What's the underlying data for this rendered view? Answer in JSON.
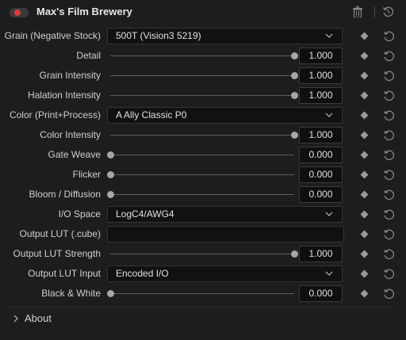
{
  "header": {
    "title": "Max's Film Brewery",
    "enabled": true,
    "toggle_color": "#e03b3b"
  },
  "rows": [
    {
      "label": "Grain (Negative Stock)",
      "type": "select",
      "value": "500T (Vision3 5219)"
    },
    {
      "label": "Detail",
      "type": "slider",
      "value": "1.000",
      "level": 1.0
    },
    {
      "label": "Grain Intensity",
      "type": "slider",
      "value": "1.000",
      "level": 1.0
    },
    {
      "label": "Halation Intensity",
      "type": "slider",
      "value": "1.000",
      "level": 1.0
    },
    {
      "label": "Color (Print+Process)",
      "type": "select",
      "value": "A Ally Classic P0"
    },
    {
      "label": "Color Intensity",
      "type": "slider",
      "value": "1.000",
      "level": 1.0
    },
    {
      "label": "Gate Weave",
      "type": "slider",
      "value": "0.000",
      "level": 0.0
    },
    {
      "label": "Flicker",
      "type": "slider",
      "value": "0.000",
      "level": 0.0
    },
    {
      "label": "Bloom / Diffusion",
      "type": "slider",
      "value": "0.000",
      "level": 0.0
    },
    {
      "label": "I/O Space",
      "type": "select",
      "value": "LogC4/AWG4"
    },
    {
      "label": "Output LUT (.cube)",
      "type": "text",
      "value": ""
    },
    {
      "label": "Output LUT Strength",
      "type": "slider",
      "value": "1.000",
      "level": 1.0
    },
    {
      "label": "Output LUT Input",
      "type": "select",
      "value": "Encoded I/O"
    },
    {
      "label": "Black & White",
      "type": "slider",
      "value": "0.000",
      "level": 0.0
    }
  ],
  "footer": {
    "about_label": "About"
  }
}
